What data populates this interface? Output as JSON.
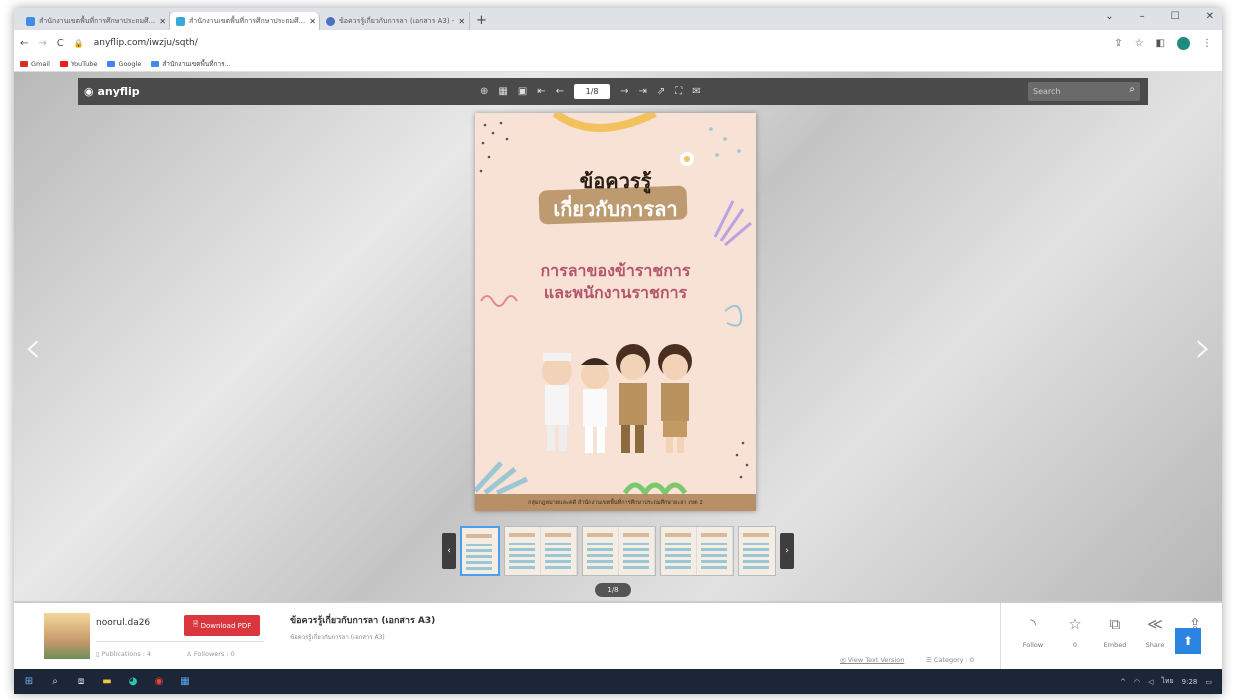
{
  "browser": {
    "tabs": [
      {
        "label": "สำนักงานเขตพื้นที่การศึกษาประถมศึ...",
        "active": false,
        "color": "#3d8ee8"
      },
      {
        "label": "สำนักงานเขตพื้นที่การศึกษาประถมศึ...",
        "active": true,
        "color": "#3aa7d9"
      },
      {
        "label": "ข้อควรรู้เกี่ยวกับการลา (เอกสาร A3) -",
        "active": false,
        "color": "#4a72c4"
      }
    ],
    "new_tab": "+",
    "url": "anyflip.com/iwzju/sqth/",
    "bookmarks": [
      {
        "label": "Gmail",
        "color": "#d93025"
      },
      {
        "label": "YouTube",
        "color": "#e62117"
      },
      {
        "label": "Google",
        "color": "#4285f4"
      },
      {
        "label": "สำนักงานเขตพื้นที่การ...",
        "color": "#3d8ee8"
      }
    ]
  },
  "viewer": {
    "brand": "anyflip",
    "page_indicator": "1/8",
    "search_placeholder": "Search",
    "page_pill": "1/8"
  },
  "book_page": {
    "title_line1": "ข้อควรรู้",
    "title_line2": "เกี่ยวกับการลา",
    "subtitle_line1": "การลาของข้าราชการ",
    "subtitle_line2": "และพนักงานราชการ",
    "footer": "กลุ่มกฎหมายและคดี สำนักงานเขตพื้นที่การศึกษาประถมศึกษายะลา เขต 2",
    "colors": {
      "background": "#f8e1d5",
      "accent_text": "#b5566c",
      "ribbon": "#bd9a70"
    }
  },
  "info": {
    "username": "noorul.da26",
    "download_label": "Download PDF",
    "publications": "Publications : 4",
    "followers": "Followers : 0",
    "doc_title": "ข้อควรรู้เกี่ยวกับการลา (เอกสาร A3)",
    "doc_description": "ข้อควรรู้เกี่ยวกับการลา (เอกสาร A3)",
    "view_text_version": "View Text Version",
    "category": "Category : 0",
    "actions": [
      {
        "label": "Follow",
        "icon": "rss-icon"
      },
      {
        "label": "0",
        "icon": "star-icon"
      },
      {
        "label": "Embed",
        "icon": "embed-icon"
      },
      {
        "label": "Share",
        "icon": "share-icon"
      },
      {
        "label": "Up",
        "icon": "upload-icon"
      }
    ]
  },
  "taskbar": {
    "time": "9:28",
    "lang": "ไทย"
  }
}
